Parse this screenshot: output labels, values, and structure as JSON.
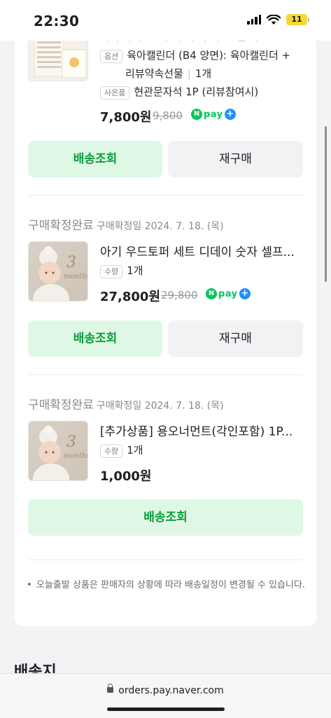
{
  "status_bar": {
    "time": "22:30",
    "battery": "11"
  },
  "items": [
    {
      "title_partial": "라이 라니 그 의 이 버 기 니 느 긴 니 ...",
      "option_tag": "옵션",
      "option_line1": "육아캘린더 (B4 양면): 육아캘린더 +",
      "option_line2": "리뷰약속선물",
      "quantity": "1개",
      "gift_tag": "사은품",
      "gift_text": "현관문자석 1P (리뷰참여시)",
      "price": "7,800원",
      "original_price": "9,800",
      "buttons": {
        "track": "배송조회",
        "reorder": "재구매"
      }
    },
    {
      "status": "구매확정완료",
      "date": "구매확정일 2024. 7. 18. (목)",
      "title": "아기 우드토퍼 세트 디데이 숫자 셀프...",
      "qty_tag": "수량",
      "quantity": "1개",
      "price": "27,800원",
      "original_price": "29,800",
      "buttons": {
        "track": "배송조회",
        "reorder": "재구매"
      }
    },
    {
      "status": "구매확정완료",
      "date": "구매확정일 2024. 7. 18. (목)",
      "title": "[추가상품] 용오너먼트(각인포함) 1P...",
      "qty_tag": "수량",
      "quantity": "1개",
      "price": "1,000원",
      "buttons": {
        "track": "배송조회"
      }
    }
  ],
  "npay": {
    "n": "N",
    "pay": "pay",
    "plus": "+"
  },
  "notice": "오늘출발 상품은 판매자의 상황에 따라 배송일정이 변경될 수 있습니다.",
  "section_title": "배송지",
  "url": "orders.pay.naver.com",
  "colors": {
    "accent_green": "#0d9b3b",
    "button_green_bg": "#dff8e6",
    "npay_green": "#03c75a"
  }
}
